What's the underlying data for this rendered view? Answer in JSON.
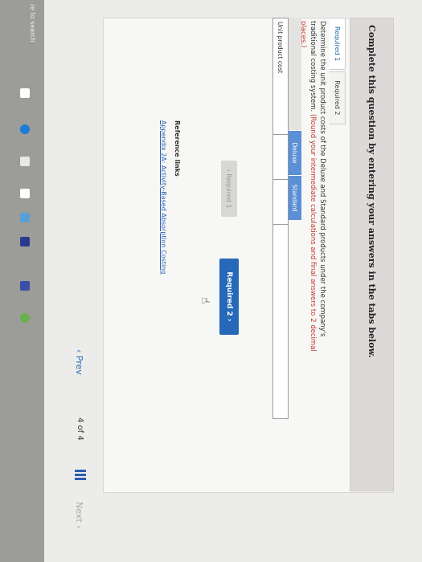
{
  "header": {
    "title": "Complete this question by entering your answers in the tabs below."
  },
  "tabs": [
    {
      "label": "Required 1"
    },
    {
      "label": "Required 2"
    }
  ],
  "instruction": {
    "text": "Determine the unit product costs of the Deluxe and Standard products under the company's traditional costing system.",
    "note": "(Round your intermediate calculations and final answers to 2 decimal places.)"
  },
  "table": {
    "columns": [
      "Deluxe",
      "Standard"
    ],
    "row_label": "Unit product cost"
  },
  "nav": {
    "required1_label": "Required 1",
    "required2_label": "Required 2"
  },
  "reference": {
    "title": "Reference links",
    "link": "Appendix 2A: Activity-Based Absorption Costing"
  },
  "pager": {
    "prev_label": "Prev",
    "page_text": "4 of 4",
    "next_label": "Next"
  },
  "taskbar": {
    "search_text": "re to search"
  },
  "colors": {
    "accent": "#2669b8",
    "header_bg": "#ddd9d8"
  }
}
